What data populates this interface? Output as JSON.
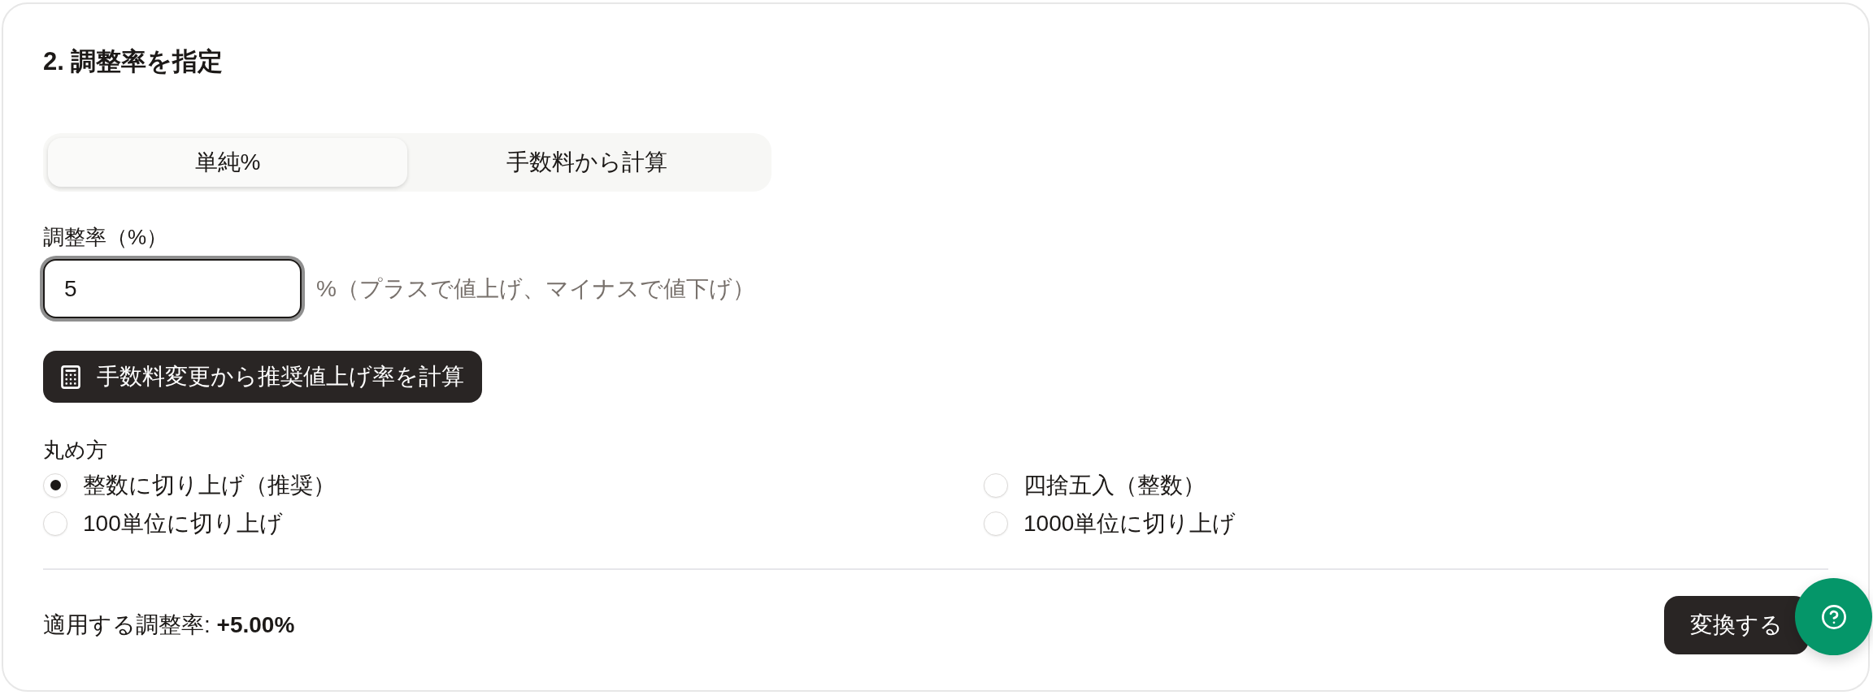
{
  "section": {
    "title": "2. 調整率を指定"
  },
  "mode_tabs": [
    {
      "label": "単純%",
      "selected": true
    },
    {
      "label": "手数料から計算",
      "selected": false
    }
  ],
  "rate_field": {
    "label": "調整率（%）",
    "value": "5",
    "focused": true,
    "hint": "%（プラスで値上げ、マイナスで値下げ）"
  },
  "calc_button": {
    "label": "手数料変更から推奨値上げ率を計算"
  },
  "rounding": {
    "label": "丸め方",
    "options": [
      {
        "label": "整数に切り上げ（推奨）",
        "selected": true
      },
      {
        "label": "四捨五入（整数）",
        "selected": false
      },
      {
        "label": "100単位に切り上げ",
        "selected": false
      },
      {
        "label": "1000単位に切り上げ",
        "selected": false
      }
    ]
  },
  "summary": {
    "text": "適用する調整率: **+5.00%**"
  },
  "convert_button": {
    "label": "変換する"
  }
}
